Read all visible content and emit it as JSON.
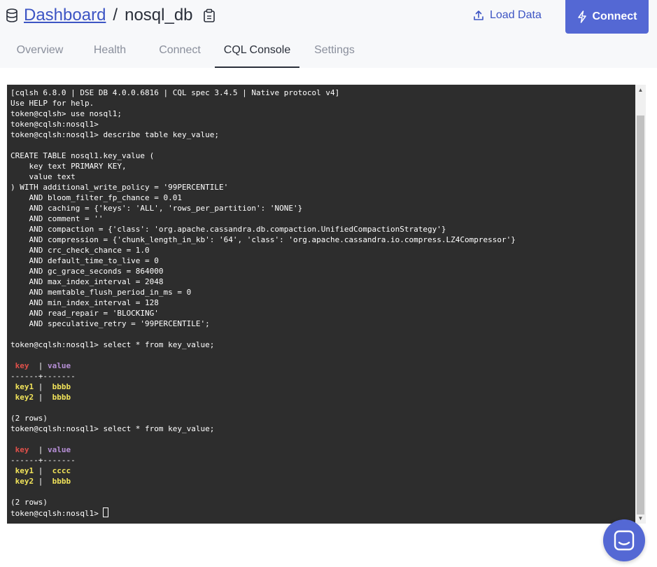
{
  "header": {
    "breadcrumb_link": "Dashboard",
    "breadcrumb_sep": "/",
    "db_name": "nosql_db",
    "load_data_label": "Load Data",
    "connect_label": "Connect"
  },
  "tabs": [
    {
      "label": "Overview"
    },
    {
      "label": "Health"
    },
    {
      "label": "Connect"
    },
    {
      "label": "CQL Console"
    },
    {
      "label": "Settings"
    }
  ],
  "active_tab": "CQL Console",
  "console": {
    "lines_top": [
      "[cqlsh 6.8.0 | DSE DB 4.0.0.6816 | CQL spec 3.4.5 | Native protocol v4]",
      "Use HELP for help.",
      "token@cqlsh> use nosql1;",
      "token@cqlsh:nosql1>",
      "token@cqlsh:nosql1> describe table key_value;",
      "",
      "CREATE TABLE nosql1.key_value (",
      "    key text PRIMARY KEY,",
      "    value text",
      ") WITH additional_write_policy = '99PERCENTILE'",
      "    AND bloom_filter_fp_chance = 0.01",
      "    AND caching = {'keys': 'ALL', 'rows_per_partition': 'NONE'}",
      "    AND comment = ''",
      "    AND compaction = {'class': 'org.apache.cassandra.db.compaction.UnifiedCompactionStrategy'}",
      "    AND compression = {'chunk_length_in_kb': '64', 'class': 'org.apache.cassandra.io.compress.LZ4Compressor'}",
      "    AND crc_check_chance = 1.0",
      "    AND default_time_to_live = 0",
      "    AND gc_grace_seconds = 864000",
      "    AND max_index_interval = 2048",
      "    AND memtable_flush_period_in_ms = 0",
      "    AND min_index_interval = 128",
      "    AND read_repair = 'BLOCKING'",
      "    AND speculative_retry = '99PERCENTILE';",
      "",
      "token@cqlsh:nosql1> select * from key_value;",
      ""
    ],
    "result1": {
      "header_key": " key ",
      "header_sep": " | ",
      "header_value": "value",
      "divider": "------+-------",
      "rows": [
        {
          "key": " key1",
          "sep": " |  ",
          "value": "bbbb"
        },
        {
          "key": " key2",
          "sep": " |  ",
          "value": "bbbb"
        }
      ],
      "count": "(2 rows)"
    },
    "query2": "token@cqlsh:nosql1> select * from key_value;",
    "result2": {
      "header_key": " key ",
      "header_sep": " | ",
      "header_value": "value",
      "divider": "------+-------",
      "rows": [
        {
          "key": " key1",
          "sep": " |  ",
          "value": "cccc"
        },
        {
          "key": " key2",
          "sep": " |  ",
          "value": "bbbb"
        }
      ],
      "count": "(2 rows)"
    },
    "prompt": "token@cqlsh:nosql1> "
  },
  "icons": {
    "db": "database-icon",
    "copy": "clipboard-icon",
    "upload": "upload-icon",
    "bolt": "lightning-icon",
    "chat": "chat-icon"
  },
  "colors": {
    "accent": "#5468d4",
    "console_bg": "#2d2d2d",
    "key_red": "#e0504a",
    "value_purple": "#b68fd6",
    "cell_yellow": "#f1e35a"
  }
}
